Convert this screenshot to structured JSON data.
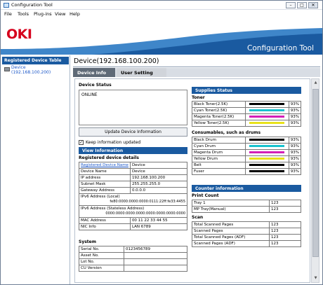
{
  "window": {
    "title": "Configuration Tool",
    "controls": [
      "–",
      "□",
      "✕"
    ]
  },
  "menu": [
    "File",
    "Tools",
    "Plug-ins",
    "View",
    "Help"
  ],
  "banner": {
    "logo": "OKI",
    "title": "Configuration Tool"
  },
  "sidebar": {
    "header": "Registered Device Table",
    "device_line1": "Device",
    "device_line2": "(192.168.100.200)"
  },
  "main": {
    "title": "Device(192.168.100.200)",
    "tabs": [
      "Device Info",
      "User Setting"
    ]
  },
  "device_status": {
    "heading": "Device Status",
    "status": "ONLINE",
    "update_button": "Update Device Information",
    "keep_label": "Keep information updated",
    "keep_checked": true
  },
  "view_info": {
    "heading": "View Information",
    "subheading": "Registered device details",
    "rows": [
      [
        "Registered Device Name",
        "Device"
      ],
      [
        "Device Name",
        "Device"
      ],
      [
        "IP address",
        "192.168.100.200"
      ],
      [
        "Subnet Mask",
        "255.255.255.0"
      ],
      [
        "Gateway Address",
        "0.0.0.0"
      ]
    ],
    "ipv6_local_label": "IPv6 Address (Local)",
    "ipv6_local": "fe80:0000:0000:0000:0111:22ff:fe33:4455",
    "ipv6_stateless_label": "IPv6 Address (Stateless Address)",
    "ipv6_stateless": "0000:0000:0000:0000:0000:0000:0000:0000",
    "rows2": [
      [
        "MAC Address",
        "00 11 22 33 44 55"
      ],
      [
        "NIC Info",
        "LAN 6789"
      ]
    ]
  },
  "system": {
    "heading": "System",
    "rows": [
      [
        "Serial No.",
        "0123456789"
      ],
      [
        "Asset No.",
        ""
      ],
      [
        "Lot No.",
        ""
      ],
      [
        "CU Version",
        ""
      ]
    ]
  },
  "supplies": {
    "heading": "Supplies Status",
    "toner_heading": "Toner",
    "toner": [
      {
        "name": "Black Toner(2.5K)",
        "pct": "93%",
        "color": "#000000"
      },
      {
        "name": "Cyan Toner(2.5K)",
        "pct": "93%",
        "color": "#19c3cf"
      },
      {
        "name": "Magenta Toner(2.5K)",
        "pct": "93%",
        "color": "#d41fb8"
      },
      {
        "name": "Yellow Toner(2.5K)",
        "pct": "93%",
        "color": "#e8e21a"
      }
    ],
    "consumables_heading": "Consumables, such as drums",
    "consumables": [
      {
        "name": "Black Drum",
        "pct": "93%",
        "color": "#000000"
      },
      {
        "name": "Cyan Drum",
        "pct": "93%",
        "color": "#19c3cf"
      },
      {
        "name": "Magenta Drum",
        "pct": "93%",
        "color": "#d41fb8"
      },
      {
        "name": "Yellow Drum",
        "pct": "93%",
        "color": "#e8e21a"
      },
      {
        "name": "Belt",
        "pct": "93%",
        "color": "#000000"
      },
      {
        "name": "Fuser",
        "pct": "93%",
        "color": "#000000"
      }
    ]
  },
  "counter": {
    "heading": "Counter information",
    "print_heading": "Print Count",
    "print": [
      [
        "Tray 1",
        "123"
      ],
      [
        "MP Tray(Manual)",
        "123"
      ]
    ],
    "scan_heading": "Scan",
    "scan": [
      [
        "Total Scanned Pages",
        "123"
      ],
      [
        "Scanned Pages",
        "123"
      ],
      [
        "Total Scanned Pages (ADF)",
        "123"
      ],
      [
        "Scanned Pages (ADF)",
        "123"
      ]
    ]
  },
  "colors": {
    "accent": "#1a5aa0",
    "oki_red": "#d6001c"
  }
}
